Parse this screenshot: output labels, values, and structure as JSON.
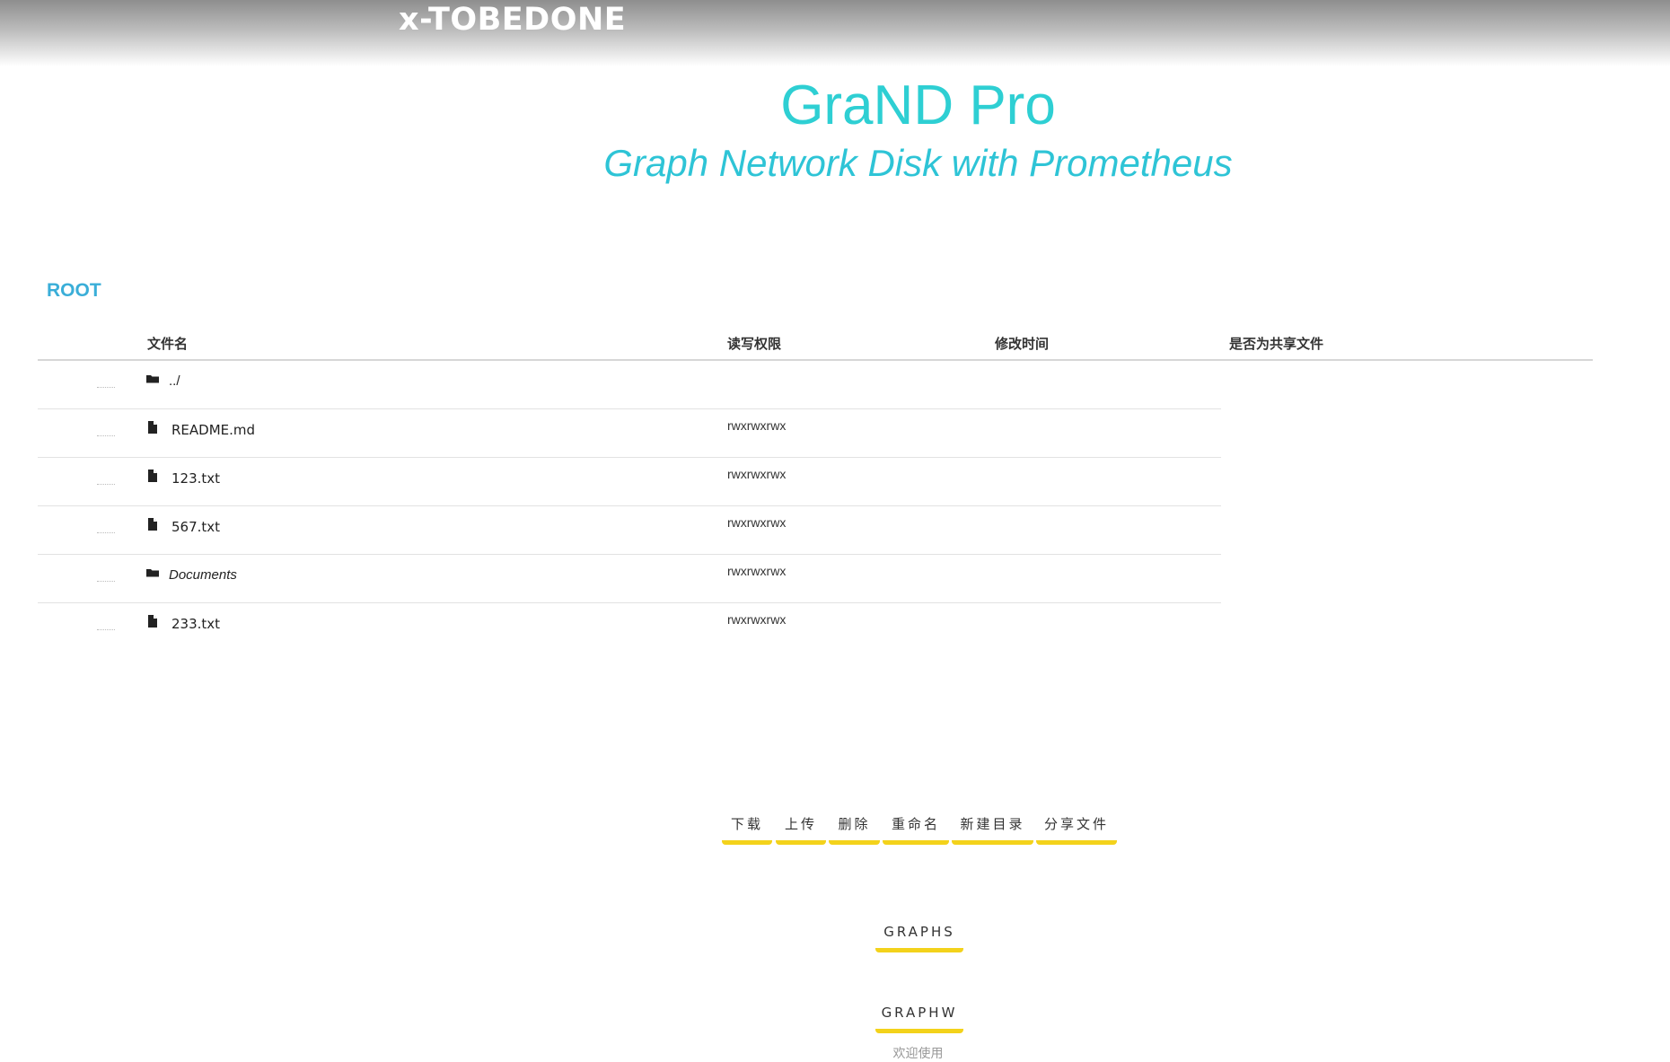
{
  "header": {
    "brand": "x-TOBEDONE"
  },
  "hero": {
    "title": "GraND Pro",
    "subtitle": "Graph Network Disk with Prometheus"
  },
  "breadcrumb": {
    "root": "ROOT"
  },
  "table": {
    "columns": [
      "文件名",
      "读写权限",
      "修改时间",
      "是否为共享文件"
    ],
    "rows": [
      {
        "type": "folder",
        "name": "../",
        "perm": ""
      },
      {
        "type": "file",
        "name": "README.md",
        "perm": "rwxrwxrwx"
      },
      {
        "type": "file",
        "name": "123.txt",
        "perm": "rwxrwxrwx"
      },
      {
        "type": "file",
        "name": "567.txt",
        "perm": "rwxrwxrwx"
      },
      {
        "type": "folder",
        "name": "Documents",
        "perm": "rwxrwxrwx"
      },
      {
        "type": "file",
        "name": "233.txt",
        "perm": "rwxrwxrwx"
      }
    ]
  },
  "actions": {
    "download": "下载",
    "upload": "上传",
    "delete": "删除",
    "rename": "重命名",
    "new_dir": "新建目录",
    "share": "分享文件"
  },
  "graphs": {
    "graphs_label": "GRAPHS",
    "graphw_label": "GRAPHW"
  },
  "footer": {
    "welcome": "欢迎使用"
  },
  "colors": {
    "accent": "#2ecfd3",
    "button_underline": "#f3d21b",
    "root_link": "#3aaed8"
  }
}
